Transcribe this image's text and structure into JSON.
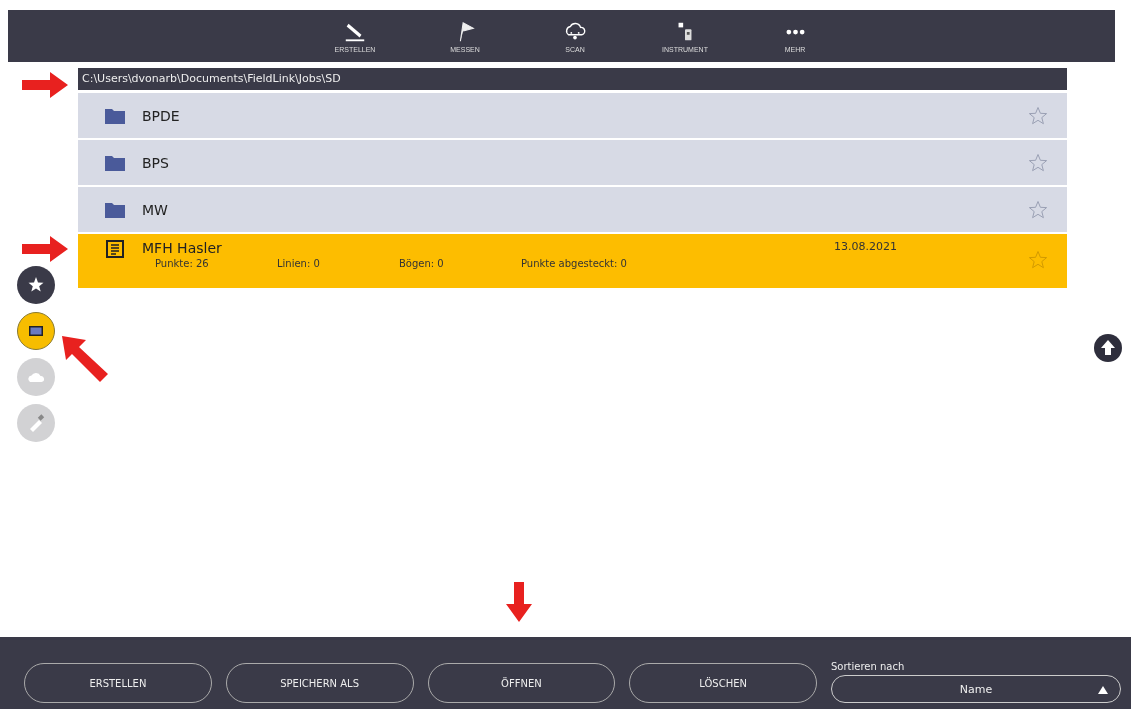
{
  "toolbar": [
    {
      "kind": "pencil",
      "label": "ERSTELLEN"
    },
    {
      "kind": "flag",
      "label": "MESSEN"
    },
    {
      "kind": "cloud",
      "label": "SCAN"
    },
    {
      "kind": "instrument",
      "label": "INSTRUMENT"
    },
    {
      "kind": "dots",
      "label": "MEHR"
    }
  ],
  "path": "C:\\Users\\dvonarb\\Documents\\FieldLink\\Jobs\\SD",
  "files": [
    {
      "kind": "folder",
      "name": "BPDE",
      "selected": false,
      "favorite": false
    },
    {
      "kind": "folder",
      "name": "BPS",
      "selected": false,
      "favorite": false
    },
    {
      "kind": "folder",
      "name": "MW",
      "selected": false,
      "favorite": false
    },
    {
      "kind": "job",
      "name": "MFH Hasler",
      "selected": true,
      "favorite": false,
      "date": "13.08.2021",
      "details": [
        "Punkte: 26",
        "Linien: 0",
        "Bögen: 0",
        "Punkte abgesteckt: 0"
      ]
    }
  ],
  "sources": [
    {
      "kind": "star",
      "selected": false,
      "disabled": false
    },
    {
      "kind": "device",
      "selected": true,
      "disabled": false
    },
    {
      "kind": "cloud",
      "selected": false,
      "disabled": true
    },
    {
      "kind": "usb",
      "selected": false,
      "disabled": true
    }
  ],
  "annotation_arrows": [
    {
      "kind": "right"
    },
    {
      "kind": "right"
    },
    {
      "kind": "diagonal"
    },
    {
      "kind": "down"
    }
  ],
  "buttons": [
    "ERSTELLEN",
    "SPEICHERN ALS",
    "ÖFFNEN",
    "LÖSCHEN"
  ],
  "sort": {
    "label": "Sortieren nach",
    "value": "Name"
  }
}
